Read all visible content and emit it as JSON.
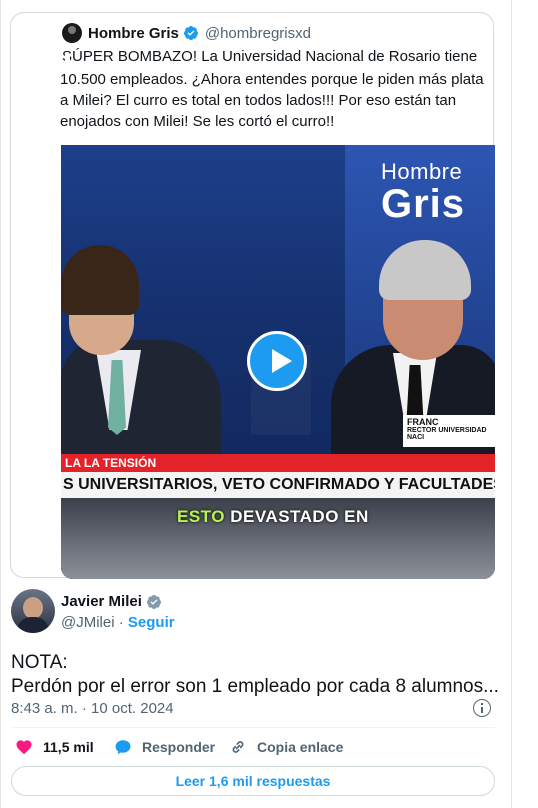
{
  "quoted_tweet": {
    "name": "Hombre Gris",
    "handle": "@hombregrisxd",
    "text": "SÚPER BOMBAZO! La Universidad Nacional de Rosario tiene 10.500 empleados. ¿Ahora entendes porque le piden más plata a Milei? El curro es total en todos lados!!! Por eso están tan enojados con Milei! Se les cortó el curro!!",
    "video": {
      "brand_line1": "Hombre",
      "brand_line2": "Gris",
      "name_tag_1": "FRANC",
      "name_tag_2": "RECTOR UNIVERSIDAD NACI",
      "ticker_red": "LA LA TENSIÓN",
      "ticker_main": "S UNIVERSITARIOS, VETO CONFIRMADO Y FACULTADES TOMADAS",
      "subtitle_highlight": "ESTO",
      "subtitle_rest": "DEVASTADO EN"
    }
  },
  "author": {
    "name": "Javier Milei",
    "handle": "@JMilei",
    "separator": "·",
    "follow_label": "Seguir"
  },
  "tweet": {
    "line1": "NOTA:",
    "line2": "Perdón por el error son 1 empleado por cada 8 alumnos...",
    "timestamp": "8:43 a. m. · 10 oct. 2024"
  },
  "actions": {
    "likes": "11,5 mil",
    "reply_label": "Responder",
    "copy_label": "Copia enlace"
  },
  "read_replies_label": "Leer 1,6 mil respuestas",
  "colors": {
    "accent": "#1d9bf0",
    "like": "#f91880",
    "text_secondary": "#536471"
  }
}
